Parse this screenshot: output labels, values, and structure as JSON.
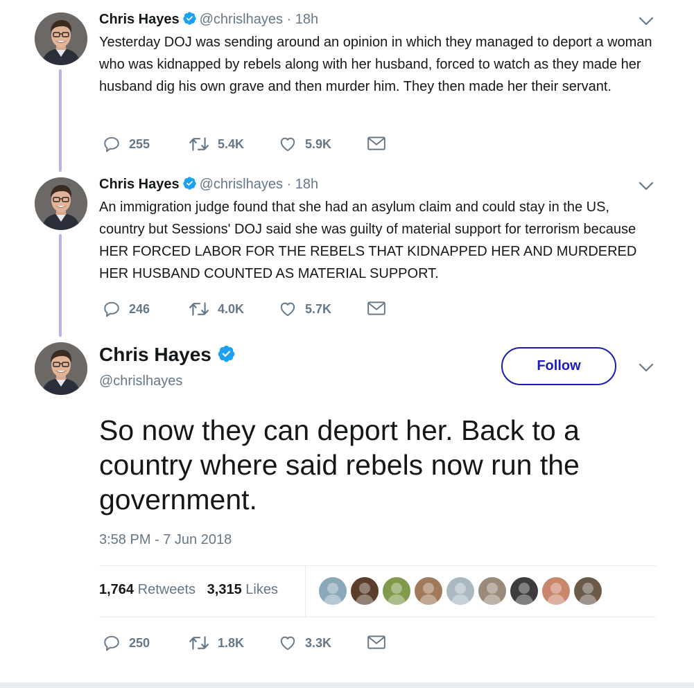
{
  "tweets": [
    {
      "name": "Chris Hayes",
      "handle": "@chrislhayes",
      "separator": "·",
      "time": "18h",
      "text": "Yesterday DOJ was sending around an opinion in which they managed to deport a woman who was kidnapped by rebels along with her husband, forced to watch as they made her husband dig his own grave and then murder him. They then made her their servant.",
      "replies": "255",
      "retweets": "5.4K",
      "likes": "5.9K"
    },
    {
      "name": "Chris Hayes",
      "handle": "@chrislhayes",
      "separator": "·",
      "time": "18h",
      "text": "An immigration judge found that she had an asylum claim and could stay in the US, country but Sessions' DOJ said she was guilty of material support for terrorism because HER FORCED LABOR FOR THE REBELS THAT KIDNAPPED HER AND MURDERED HER HUSBAND COUNTED AS MATERIAL SUPPORT.",
      "replies": "246",
      "retweets": "4.0K",
      "likes": "5.7K"
    }
  ],
  "main_tweet": {
    "name": "Chris Hayes",
    "handle": "@chrislhayes",
    "follow_label": "Follow",
    "text": "So now they can deport her. Back to a country where said rebels now run the government.",
    "timestamp": "3:58 PM - 7 Jun 2018",
    "retweet_count": "1,764",
    "retweet_label": "Retweets",
    "like_count": "3,315",
    "like_label": "Likes",
    "replies": "250",
    "retweets": "1.8K",
    "likes": "3.3K"
  },
  "icons": {
    "reply": "reply-icon",
    "retweet": "retweet-icon",
    "like": "heart-icon",
    "dm": "envelope-icon",
    "more": "chevron-down-icon",
    "verified": "verified-badge-icon"
  },
  "colors": {
    "text": "#14171a",
    "muted": "#657786",
    "follow_border": "#1b1bb5",
    "verified": "#1da1f2",
    "thread_line": "#b8b2f0",
    "divider": "#e6ecf0"
  },
  "liker_avatars": [
    "#8aa9b8",
    "#5a3d2b",
    "#7f9a4a",
    "#a07a5a",
    "#aab8c2",
    "#9a8a7a",
    "#3d3d3d",
    "#c9866b",
    "#6b5a4a"
  ]
}
